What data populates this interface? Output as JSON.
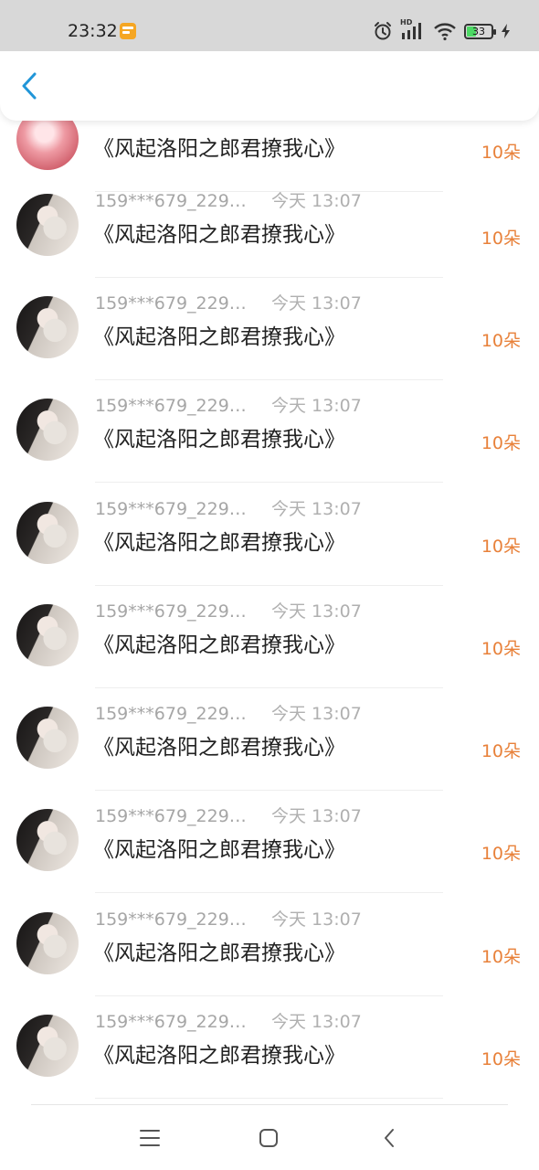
{
  "status_bar": {
    "time": "23:32",
    "network_label": "HD",
    "battery_percent": "33",
    "icons": [
      "alarm-icon",
      "signal-icon",
      "wifi-icon",
      "battery-icon",
      "charging-icon"
    ]
  },
  "header": {
    "back_icon": "chevron-left-icon",
    "accent_color": "#2196d8"
  },
  "rows": [
    {
      "username": "",
      "time": "",
      "title": "《风起洛阳之郎君撩我心》",
      "amount": "10朵",
      "avatar": "pink-avatar"
    },
    {
      "username": "159***679_229…",
      "time": "今天 13:07",
      "title": "《风起洛阳之郎君撩我心》",
      "amount": "10朵",
      "avatar": "girl-avatar"
    },
    {
      "username": "159***679_229…",
      "time": "今天 13:07",
      "title": "《风起洛阳之郎君撩我心》",
      "amount": "10朵",
      "avatar": "girl-avatar"
    },
    {
      "username": "159***679_229…",
      "time": "今天 13:07",
      "title": "《风起洛阳之郎君撩我心》",
      "amount": "10朵",
      "avatar": "girl-avatar"
    },
    {
      "username": "159***679_229…",
      "time": "今天 13:07",
      "title": "《风起洛阳之郎君撩我心》",
      "amount": "10朵",
      "avatar": "girl-avatar"
    },
    {
      "username": "159***679_229…",
      "time": "今天 13:07",
      "title": "《风起洛阳之郎君撩我心》",
      "amount": "10朵",
      "avatar": "girl-avatar"
    },
    {
      "username": "159***679_229…",
      "time": "今天 13:07",
      "title": "《风起洛阳之郎君撩我心》",
      "amount": "10朵",
      "avatar": "girl-avatar"
    },
    {
      "username": "159***679_229…",
      "time": "今天 13:07",
      "title": "《风起洛阳之郎君撩我心》",
      "amount": "10朵",
      "avatar": "girl-avatar"
    },
    {
      "username": "159***679_229…",
      "time": "今天 13:07",
      "title": "《风起洛阳之郎君撩我心》",
      "amount": "10朵",
      "avatar": "girl-avatar"
    },
    {
      "username": "159***679_229…",
      "time": "今天 13:07",
      "title": "《风起洛阳之郎君撩我心》",
      "amount": "10朵",
      "avatar": "girl-avatar"
    }
  ],
  "colors": {
    "amount": "#e8813a",
    "username": "#a6a6a6",
    "title": "#222222"
  },
  "nav_bar": {
    "icons": [
      "menu-icon",
      "home-icon",
      "back-icon"
    ]
  }
}
